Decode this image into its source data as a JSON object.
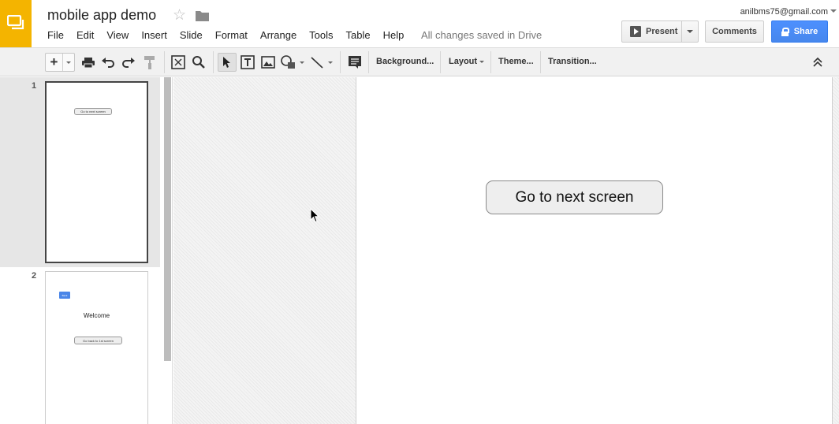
{
  "document": {
    "title": "mobile app demo",
    "save_status": "All changes saved in Drive"
  },
  "account": {
    "email": "anilbms75@gmail.com"
  },
  "menu": [
    {
      "label": "File"
    },
    {
      "label": "Edit"
    },
    {
      "label": "View"
    },
    {
      "label": "Insert"
    },
    {
      "label": "Slide"
    },
    {
      "label": "Format"
    },
    {
      "label": "Arrange"
    },
    {
      "label": "Tools"
    },
    {
      "label": "Table"
    },
    {
      "label": "Help"
    }
  ],
  "header_buttons": {
    "present": "Present",
    "comments": "Comments",
    "share": "Share"
  },
  "toolbar": {
    "new_slide_label": "+",
    "background": "Background...",
    "layout": "Layout",
    "theme": "Theme...",
    "transition": "Transition...",
    "icons": [
      "plus-icon",
      "print-icon",
      "undo-icon",
      "redo-icon",
      "paint-format-icon",
      "zoom-fit-icon",
      "zoom-icon",
      "select-cursor-icon",
      "text-box-icon",
      "image-icon",
      "shape-icon",
      "line-icon",
      "comment-icon",
      "collapse-toolbar-icon"
    ]
  },
  "slides": [
    {
      "number": "1",
      "button_label": "Go to next screen"
    },
    {
      "number": "2",
      "back_label": "Back",
      "heading": "Welcome",
      "button_label": "Go back to 1st screen"
    }
  ],
  "current_slide": {
    "button_label": "Go to next screen"
  },
  "colors": {
    "brand": "#f4b400",
    "share": "#4d90fe",
    "accent_back": "#4a86e8"
  }
}
